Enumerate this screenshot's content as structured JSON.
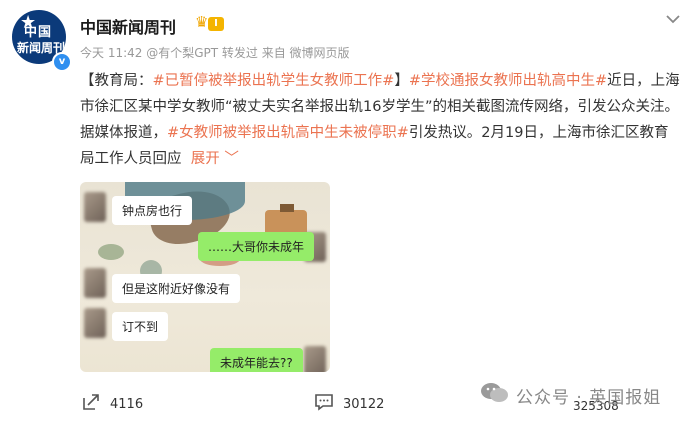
{
  "header": {
    "avatar_line1": "中国",
    "avatar_line2": "新闻周刊",
    "verified_mark": "v",
    "account_name": "中国新闻周刊",
    "level_badge": "I",
    "meta_line": "今天 11:42 @有个梨GPT 转发过   来自 微博网页版",
    "menu_icon": "chevron-down-icon"
  },
  "post": {
    "source_prefix": "【教育局：",
    "tag1": "#已暂停被举报出轨学生女教师工作#",
    "bracket_close": "】",
    "tag2": "#学校通报女教师出轨高中生#",
    "text1": "近日，上海市徐汇区某中学女教师“被丈夫实名举报出轨16岁学生”的相关截图流传网络，引发公众关注。据媒体报道，",
    "tag3": "#女教师被举报出轨高中生未被停职#",
    "text2": "引发热议。2月19日，上海市徐汇区教育局工作人员回应",
    "expand": "展开",
    "expand_icon": "﹀"
  },
  "image": {
    "messages": [
      {
        "side": "left",
        "text": "钟点房也行"
      },
      {
        "side": "right",
        "text": "……大哥你未成年"
      },
      {
        "side": "left",
        "text": "但是这附近好像没有"
      },
      {
        "side": "left",
        "text": "订不到"
      },
      {
        "side": "right",
        "text": "未成年能去??"
      }
    ]
  },
  "actions": {
    "repost_count": "4116",
    "comment_count": "30122",
    "like_count": "325308"
  },
  "watermark": {
    "text": "公众号 · 英国报姐"
  },
  "colors": {
    "tag": "#eb7350",
    "wechat_green": "#95ec69",
    "avatar_bg": "#0b3a7a"
  }
}
